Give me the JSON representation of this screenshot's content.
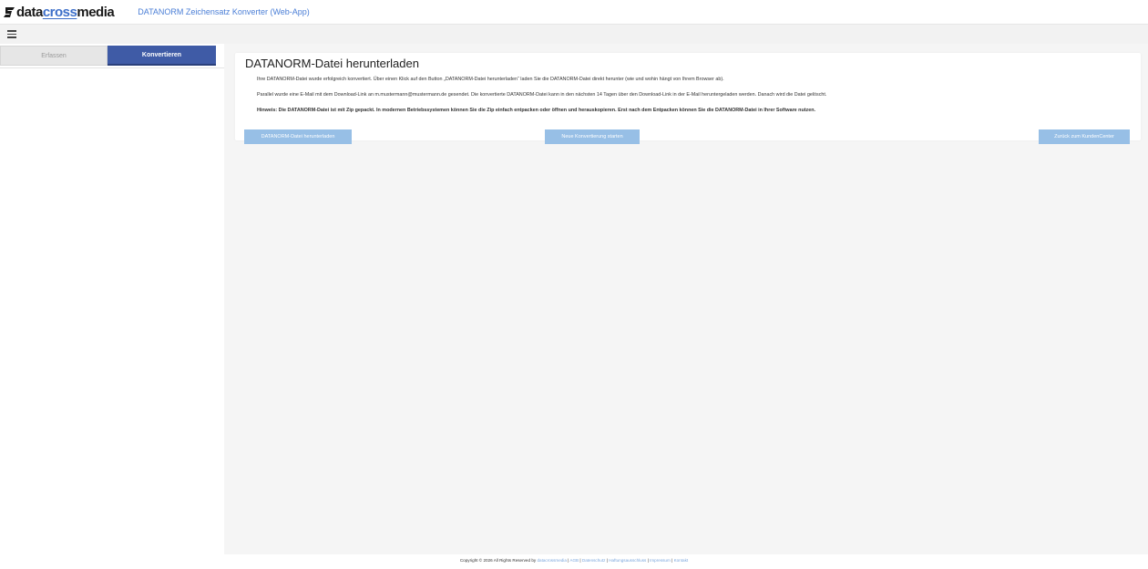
{
  "header": {
    "brand_part1": "data",
    "brand_part2": "cross",
    "brand_part3": "media",
    "app_title": "DATANORM Zeichensatz Konverter (Web-App)",
    "logo_icon": "brand-logo-icon",
    "menu_icon": "hamburger-icon"
  },
  "sidebar": {
    "tabs": [
      {
        "label": "Erfassen",
        "active": false
      },
      {
        "label": "Konvertieren",
        "active": true
      }
    ]
  },
  "main": {
    "title": "DATANORM-Datei herunterladen",
    "paragraph1": "Ihre DATANORM-Datei wurde erfolgreich konvertiert. Über einen Klick auf den Button „DATANORM-Datei herunterladen“ laden Sie die DATANORM-Datei direkt herunter (wie und wohin hängt von Ihrem Browser ab).",
    "paragraph2": "Parallel wurde eine E-Mail mit dem Download-Link an m.mustermann@mustermann.de gesendet. Die konvertierte DATANORM-Datei kann in den nächsten 14 Tagen über den Download-Link in der E-Mail heruntergeladen werden. Danach wird die Datei gelöscht.",
    "hint": "Hinweis: Die DATANORM-Datei ist mit Zip gepackt. In modernen Betriebssystemen können Sie die Zip einfach entpacken oder öffnen und herauskopieren. Erst nach dem Entpacken können Sie die DATANORM-Datei in Ihrer Software nutzen.",
    "buttons": {
      "download": "DATANORM-Datei herunterladen",
      "new": "Neue Konvertierung starten",
      "back": "Zurück zum KundenCenter"
    }
  },
  "footer": {
    "copyright": "Copyright © 2026 All Rights Reserved by",
    "brand": "datacrossmedia",
    "sep": "|",
    "links": [
      "AGB",
      "Datenschutz",
      "Haftungsausschluss",
      "Impressum",
      "Kontakt"
    ]
  },
  "colors": {
    "accent": "#3f5ba6",
    "button": "#97bfe6",
    "title_link": "#4a7ed6"
  }
}
